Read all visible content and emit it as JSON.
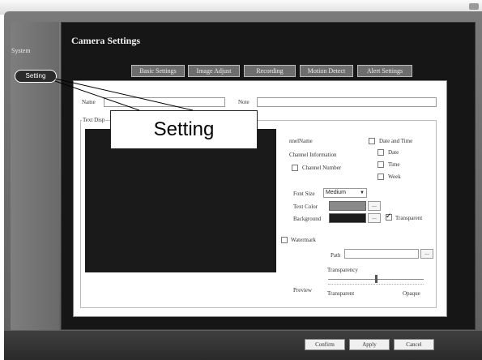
{
  "sidebar": {
    "section": "System",
    "button": "Setting"
  },
  "header": {
    "title": "Camera Settings"
  },
  "tabs": [
    "Basic Settings",
    "Image Adjust",
    "Recording",
    "Motion Detect",
    "Alert Settings"
  ],
  "form": {
    "name_label": "Name",
    "note_label": "Note",
    "text_display_label": "Text Disp",
    "channel_name": "nnelName",
    "channel_information": "Channel Information",
    "channel_number": "Channel Number",
    "date_and_time": "Date and Time",
    "date": "Date",
    "time": "Time",
    "week": "Week",
    "font_size_label": "Font Size",
    "font_size_value": "Medium",
    "text_color_label": "Text Color",
    "background_label": "Background",
    "transparent_check": "Transparent",
    "dots": "...",
    "watermark": "Watermark",
    "path_label": "Path",
    "transparency_label": "Transparency",
    "preview_label": "Preview",
    "slider_min": "Transparent",
    "slider_max": "Opaque",
    "transparency_value": 0.5
  },
  "footer": {
    "confirm": "Confirm",
    "apply": "Apply",
    "cancel": "Cancel"
  },
  "callout": "Setting",
  "colors": {
    "text_color": "#8a8a8a",
    "background_color": "#1c1c1c"
  }
}
